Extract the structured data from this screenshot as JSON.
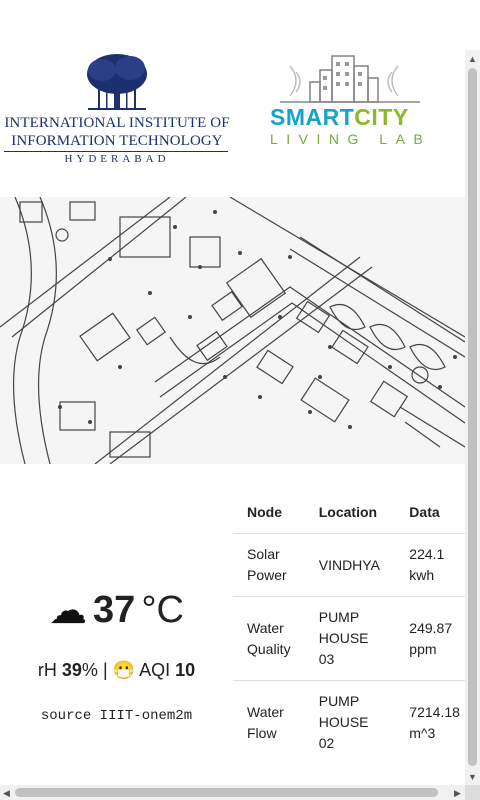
{
  "header": {
    "iiit_logo": {
      "line1": "INTERNATIONAL INSTITUTE OF",
      "line2": "INFORMATION TECHNOLOGY",
      "line3": "HYDERABAD"
    },
    "smartcity_logo": {
      "title_part1": "SMART",
      "title_part2": "CITY",
      "subtitle": "LIVING LAB"
    }
  },
  "map": {
    "kind": "campus-map"
  },
  "weather": {
    "condition_icon": "cloud-icon",
    "condition_glyph": "☁",
    "temperature": "37",
    "temperature_unit": "°C",
    "humidity_icon": "",
    "humidity_label": "rH",
    "humidity_value": "39",
    "humidity_unit": "%",
    "separator": "|",
    "aqi_icon": "😷",
    "aqi_label": "AQI",
    "aqi_value": "10",
    "source": "source IIIT-onem2m"
  },
  "table": {
    "headers": [
      "Node",
      "Location",
      "Data"
    ],
    "rows": [
      [
        "Solar Power",
        "VINDHYA",
        "224.1 kwh"
      ],
      [
        "Water Quality",
        "PUMP HOUSE 03",
        "249.87 ppm"
      ],
      [
        "Water Flow",
        "PUMP HOUSE 02",
        "7214.18 m^3"
      ]
    ]
  },
  "colors": {
    "iiit_blue": "#1d2f6e",
    "smart_blue": "#17a3c9",
    "city_green": "#8ab92d",
    "map_line": "#444444"
  }
}
